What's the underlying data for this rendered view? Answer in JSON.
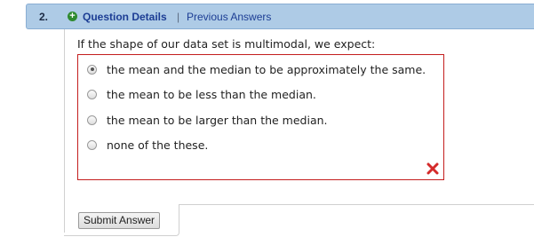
{
  "header": {
    "question_number": "2.",
    "details_label": "Question Details",
    "separator": "|",
    "previous_answers_label": "Previous Answers",
    "expand_icon": "plus-circle-icon"
  },
  "question": {
    "prompt": "If the shape of our data set is multimodal, we expect:",
    "options": [
      {
        "label": "the mean and the median to be approximately the same.",
        "selected": true
      },
      {
        "label": "the mean to be less than the median.",
        "selected": false
      },
      {
        "label": "the mean to be larger than the median.",
        "selected": false
      },
      {
        "label": "none of the these.",
        "selected": false
      }
    ],
    "result_icon": "incorrect-x-icon"
  },
  "actions": {
    "submit_label": "Submit Answer"
  },
  "colors": {
    "header_bg": "#aecbe6",
    "link": "#1c3d94",
    "incorrect": "#c41e1e",
    "plus_icon": "#2f8a2f"
  }
}
